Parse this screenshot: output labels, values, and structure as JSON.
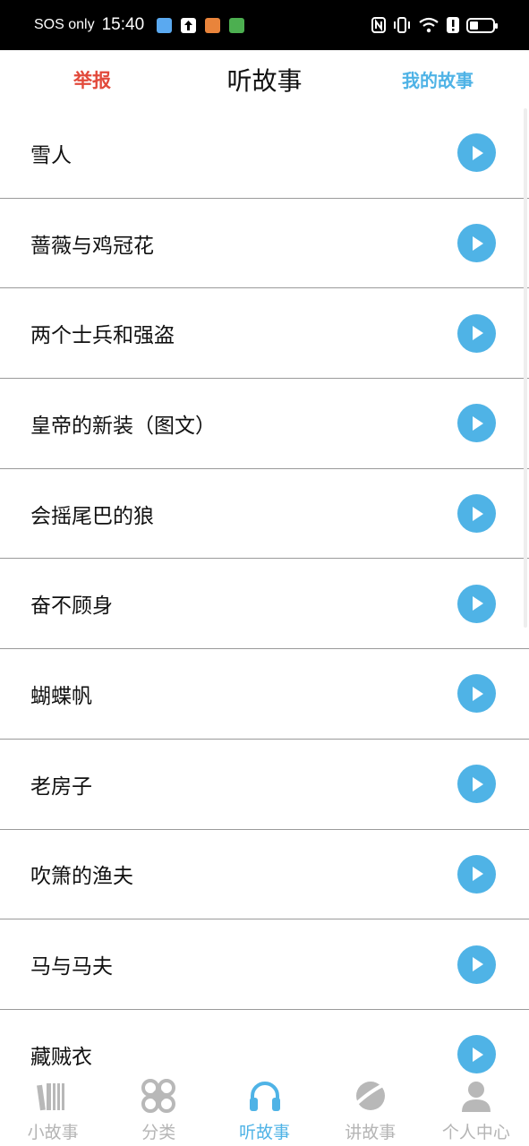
{
  "status_bar": {
    "carrier": "SOS only",
    "time": "15:40",
    "app_colors": [
      "#5aa9f0",
      "#ffffff",
      "#e9843b",
      "#4caf50"
    ]
  },
  "header": {
    "report_label": "举报",
    "title": "听故事",
    "my_stories_label": "我的故事",
    "report_color": "#e24a3b",
    "accent_color": "#4fb3e6"
  },
  "stories": [
    {
      "title": "雪人"
    },
    {
      "title": "蔷薇与鸡冠花"
    },
    {
      "title": "两个士兵和强盗"
    },
    {
      "title": "皇帝的新装（图文）"
    },
    {
      "title": "会摇尾巴的狼"
    },
    {
      "title": "奋不顾身"
    },
    {
      "title": "蝴蝶帆"
    },
    {
      "title": "老房子"
    },
    {
      "title": "吹箫的渔夫"
    },
    {
      "title": "马与马夫"
    },
    {
      "title": "藏贼衣"
    }
  ],
  "tabs": [
    {
      "label": "小故事",
      "icon": "books-icon",
      "active": false
    },
    {
      "label": "分类",
      "icon": "category-icon",
      "active": false
    },
    {
      "label": "听故事",
      "icon": "headphones-icon",
      "active": true
    },
    {
      "label": "讲故事",
      "icon": "planet-icon",
      "active": false
    },
    {
      "label": "个人中心",
      "icon": "person-icon",
      "active": false
    }
  ]
}
